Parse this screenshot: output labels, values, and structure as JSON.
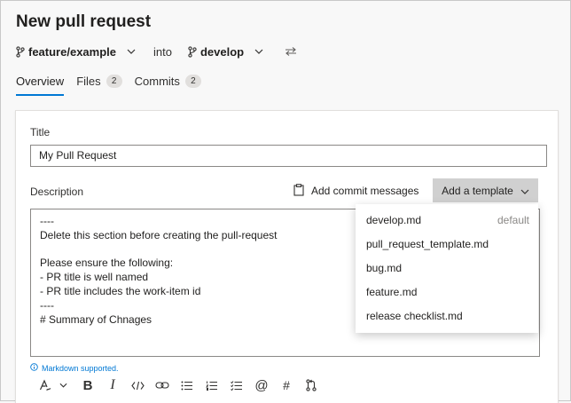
{
  "page": {
    "title": "New pull request"
  },
  "branches": {
    "source": "feature/example",
    "connector": "into",
    "target": "develop"
  },
  "tabs": [
    {
      "label": "Overview",
      "count": null
    },
    {
      "label": "Files",
      "count": "2"
    },
    {
      "label": "Commits",
      "count": "2"
    }
  ],
  "form": {
    "title_label": "Title",
    "title_value": "My Pull Request",
    "description_label": "Description",
    "add_commit_label": "Add commit messages",
    "add_template_label": "Add a template",
    "description_text": "----\nDelete this section before creating the pull-request\n\nPlease ensure the following:\n- PR title is well named\n- PR title includes the work-item id\n----\n# Summary of Chnages",
    "markdown_note": "Markdown supported."
  },
  "template_menu": {
    "items": [
      {
        "label": "develop.md",
        "badge": "default"
      },
      {
        "label": "pull_request_template.md"
      },
      {
        "label": "bug.md"
      },
      {
        "label": "feature.md"
      },
      {
        "label": "release checklist.md"
      }
    ]
  },
  "toolbar": {
    "icons": [
      "format-text-icon",
      "chevron-down-icon",
      "bold-icon",
      "italic-icon",
      "code-icon",
      "link-icon",
      "bulleted-list-icon",
      "numbered-list-icon",
      "task-list-icon",
      "mention-icon",
      "work-item-hash-icon",
      "pull-request-icon"
    ],
    "bold_glyph": "B",
    "italic_glyph": "I",
    "mention_glyph": "@",
    "hash_glyph": "#"
  },
  "colors": {
    "accent": "#0078d4",
    "template_button_bg": "#d0d0d0",
    "badge_bg": "#e1dfdd"
  }
}
